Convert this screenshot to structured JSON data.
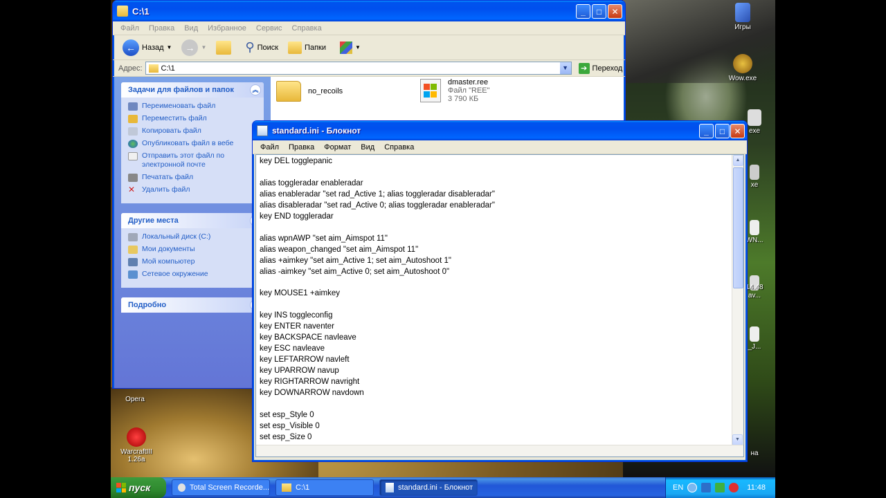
{
  "desktop": {
    "icons": [
      {
        "label": "Игры"
      },
      {
        "label": "Wow.exe"
      },
      {
        "label": "exe"
      },
      {
        "label": "xe"
      },
      {
        "label": "WN..."
      },
      {
        "label": "av..."
      },
      {
        "label": "14.48"
      },
      {
        "label": "_J..."
      },
      {
        "label": "на"
      },
      {
        "label": "Opera"
      },
      {
        "label": "WarcraftIII 1.26a"
      }
    ]
  },
  "explorer": {
    "title": "C:\\1",
    "menu": [
      "Файл",
      "Правка",
      "Вид",
      "Избранное",
      "Сервис",
      "Справка"
    ],
    "toolbar": {
      "back": "Назад",
      "search": "Поиск",
      "folders": "Папки"
    },
    "address": {
      "label": "Адрес:",
      "value": "C:\\1",
      "go": "Переход"
    },
    "tasks": {
      "title": "Задачи для файлов и папок",
      "items": [
        "Переименовать файл",
        "Переместить файл",
        "Копировать файл",
        "Опубликовать файл в вебе",
        "Отправить этот файл по электронной почте",
        "Печатать файл",
        "Удалить файл"
      ]
    },
    "places": {
      "title": "Другие места",
      "items": [
        "Локальный диск (C:)",
        "Мои документы",
        "Мой компьютер",
        "Сетевое окружение"
      ]
    },
    "details": {
      "title": "Подробно"
    },
    "files": [
      {
        "name": "no_recoils"
      },
      {
        "name": "dmaster.ree",
        "type": "Файл \"REE\"",
        "size": "3 790 КБ"
      }
    ]
  },
  "notepad": {
    "title": "standard.ini - Блокнот",
    "menu": [
      "Файл",
      "Правка",
      "Формат",
      "Вид",
      "Справка"
    ],
    "text": "key DEL togglepanic\n\nalias toggleradar enableradar\nalias enableradar \"set rad_Active 1; alias toggleradar disableradar\"\nalias disableradar \"set rad_Active 0; alias toggleradar enableradar\"\nkey END toggleradar\n\nalias wpnAWP \"set aim_Aimspot 11\"\nalias weapon_changed \"set aim_Aimspot 11\"\nalias +aimkey \"set aim_Active 1; set aim_Autoshoot 1\"\nalias -aimkey \"set aim_Active 0; set aim_Autoshoot 0\"\n\nkey MOUSE1 +aimkey\n\nkey INS toggleconfig\nkey ENTER naventer\nkey BACKSPACE navleave\nkey ESC navleave\nkey LEFTARROW navleft\nkey UPARROW navup\nkey RIGHTARROW navright\nkey DOWNARROW navdown\n\nset esp_Style 0\nset esp_Visible 0\nset esp_Size 0"
  },
  "taskbar": {
    "start": "пуск",
    "tasks": [
      "Total Screen Recorde...",
      "C:\\1",
      "standard.ini - Блокнот"
    ],
    "lang": "EN",
    "clock": "11:48"
  }
}
